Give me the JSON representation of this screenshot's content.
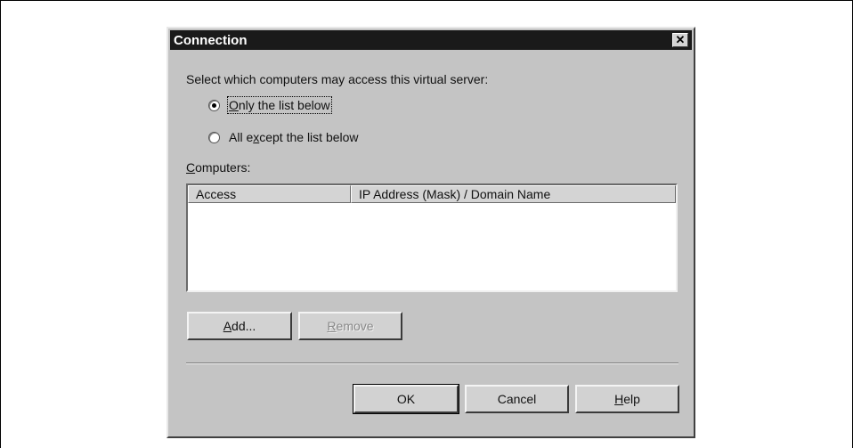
{
  "dialog": {
    "title": "Connection",
    "close_symbol": "✕",
    "prompt": "Select which computers may access this virtual server:",
    "radio_options": [
      {
        "mnemonic": "O",
        "rest": "nly the list below",
        "selected": true
      },
      {
        "prefix": "All e",
        "mnemonic": "x",
        "rest": "cept the list below",
        "selected": false
      }
    ],
    "computers_label": {
      "mnemonic": "C",
      "rest": "omputers:"
    },
    "list_columns": [
      "Access",
      "IP Address (Mask) / Domain Name"
    ],
    "list_rows": [],
    "buttons": {
      "add": {
        "mnemonic": "A",
        "rest": "dd..."
      },
      "remove": {
        "mnemonic": "R",
        "rest": "emove",
        "disabled": true
      },
      "ok": "OK",
      "cancel": "Cancel",
      "help": {
        "mnemonic": "H",
        "rest": "elp"
      }
    }
  },
  "colors": {
    "dialog_bg": "#c4c4c4",
    "titlebar_bg": "#1a1a1a",
    "titlebar_text": "#ffffff"
  }
}
